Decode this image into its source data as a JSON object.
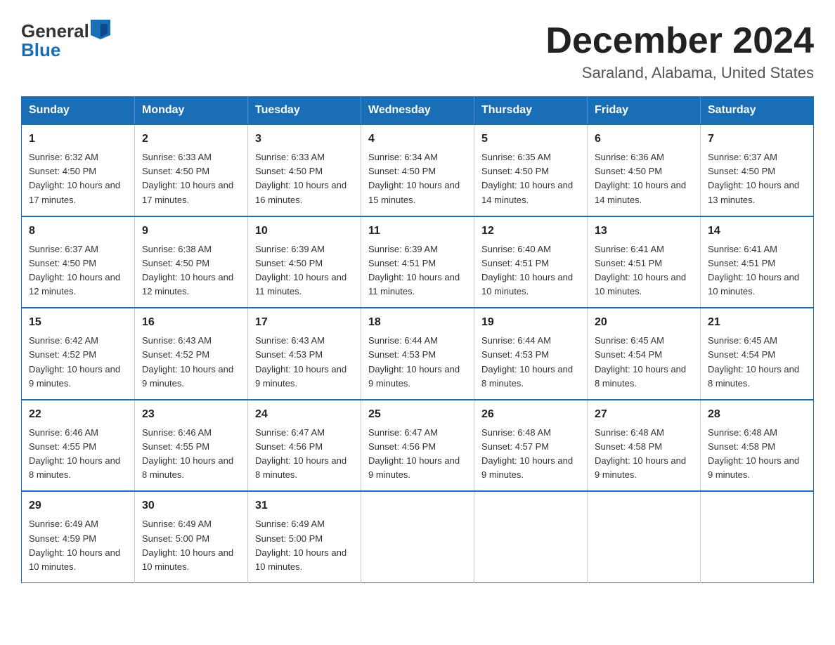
{
  "header": {
    "logo_general": "General",
    "logo_blue": "Blue",
    "month_title": "December 2024",
    "location": "Saraland, Alabama, United States"
  },
  "weekdays": [
    "Sunday",
    "Monday",
    "Tuesday",
    "Wednesday",
    "Thursday",
    "Friday",
    "Saturday"
  ],
  "weeks": [
    [
      {
        "day": "1",
        "sunrise": "6:32 AM",
        "sunset": "4:50 PM",
        "daylight": "10 hours and 17 minutes."
      },
      {
        "day": "2",
        "sunrise": "6:33 AM",
        "sunset": "4:50 PM",
        "daylight": "10 hours and 17 minutes."
      },
      {
        "day": "3",
        "sunrise": "6:33 AM",
        "sunset": "4:50 PM",
        "daylight": "10 hours and 16 minutes."
      },
      {
        "day": "4",
        "sunrise": "6:34 AM",
        "sunset": "4:50 PM",
        "daylight": "10 hours and 15 minutes."
      },
      {
        "day": "5",
        "sunrise": "6:35 AM",
        "sunset": "4:50 PM",
        "daylight": "10 hours and 14 minutes."
      },
      {
        "day": "6",
        "sunrise": "6:36 AM",
        "sunset": "4:50 PM",
        "daylight": "10 hours and 14 minutes."
      },
      {
        "day": "7",
        "sunrise": "6:37 AM",
        "sunset": "4:50 PM",
        "daylight": "10 hours and 13 minutes."
      }
    ],
    [
      {
        "day": "8",
        "sunrise": "6:37 AM",
        "sunset": "4:50 PM",
        "daylight": "10 hours and 12 minutes."
      },
      {
        "day": "9",
        "sunrise": "6:38 AM",
        "sunset": "4:50 PM",
        "daylight": "10 hours and 12 minutes."
      },
      {
        "day": "10",
        "sunrise": "6:39 AM",
        "sunset": "4:50 PM",
        "daylight": "10 hours and 11 minutes."
      },
      {
        "day": "11",
        "sunrise": "6:39 AM",
        "sunset": "4:51 PM",
        "daylight": "10 hours and 11 minutes."
      },
      {
        "day": "12",
        "sunrise": "6:40 AM",
        "sunset": "4:51 PM",
        "daylight": "10 hours and 10 minutes."
      },
      {
        "day": "13",
        "sunrise": "6:41 AM",
        "sunset": "4:51 PM",
        "daylight": "10 hours and 10 minutes."
      },
      {
        "day": "14",
        "sunrise": "6:41 AM",
        "sunset": "4:51 PM",
        "daylight": "10 hours and 10 minutes."
      }
    ],
    [
      {
        "day": "15",
        "sunrise": "6:42 AM",
        "sunset": "4:52 PM",
        "daylight": "10 hours and 9 minutes."
      },
      {
        "day": "16",
        "sunrise": "6:43 AM",
        "sunset": "4:52 PM",
        "daylight": "10 hours and 9 minutes."
      },
      {
        "day": "17",
        "sunrise": "6:43 AM",
        "sunset": "4:53 PM",
        "daylight": "10 hours and 9 minutes."
      },
      {
        "day": "18",
        "sunrise": "6:44 AM",
        "sunset": "4:53 PM",
        "daylight": "10 hours and 9 minutes."
      },
      {
        "day": "19",
        "sunrise": "6:44 AM",
        "sunset": "4:53 PM",
        "daylight": "10 hours and 8 minutes."
      },
      {
        "day": "20",
        "sunrise": "6:45 AM",
        "sunset": "4:54 PM",
        "daylight": "10 hours and 8 minutes."
      },
      {
        "day": "21",
        "sunrise": "6:45 AM",
        "sunset": "4:54 PM",
        "daylight": "10 hours and 8 minutes."
      }
    ],
    [
      {
        "day": "22",
        "sunrise": "6:46 AM",
        "sunset": "4:55 PM",
        "daylight": "10 hours and 8 minutes."
      },
      {
        "day": "23",
        "sunrise": "6:46 AM",
        "sunset": "4:55 PM",
        "daylight": "10 hours and 8 minutes."
      },
      {
        "day": "24",
        "sunrise": "6:47 AM",
        "sunset": "4:56 PM",
        "daylight": "10 hours and 8 minutes."
      },
      {
        "day": "25",
        "sunrise": "6:47 AM",
        "sunset": "4:56 PM",
        "daylight": "10 hours and 9 minutes."
      },
      {
        "day": "26",
        "sunrise": "6:48 AM",
        "sunset": "4:57 PM",
        "daylight": "10 hours and 9 minutes."
      },
      {
        "day": "27",
        "sunrise": "6:48 AM",
        "sunset": "4:58 PM",
        "daylight": "10 hours and 9 minutes."
      },
      {
        "day": "28",
        "sunrise": "6:48 AM",
        "sunset": "4:58 PM",
        "daylight": "10 hours and 9 minutes."
      }
    ],
    [
      {
        "day": "29",
        "sunrise": "6:49 AM",
        "sunset": "4:59 PM",
        "daylight": "10 hours and 10 minutes."
      },
      {
        "day": "30",
        "sunrise": "6:49 AM",
        "sunset": "5:00 PM",
        "daylight": "10 hours and 10 minutes."
      },
      {
        "day": "31",
        "sunrise": "6:49 AM",
        "sunset": "5:00 PM",
        "daylight": "10 hours and 10 minutes."
      },
      null,
      null,
      null,
      null
    ]
  ]
}
